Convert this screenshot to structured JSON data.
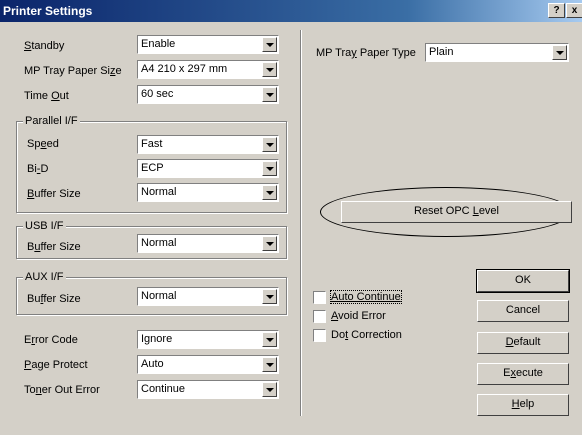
{
  "window": {
    "title": "Printer Settings",
    "help_btn": "?",
    "close_btn": "x"
  },
  "fields": {
    "standby": {
      "label_pre": "",
      "label_ul": "S",
      "label_post": "tandby",
      "value": "Enable"
    },
    "mp_tray_paper_size": {
      "label_pre": "MP Tray Paper Si",
      "label_ul": "z",
      "label_post": "e",
      "value": "A4 210 x 297 mm"
    },
    "time_out": {
      "label_pre": "Time ",
      "label_ul": "O",
      "label_post": "ut",
      "value": "60 sec"
    },
    "error_code": {
      "label_pre": "E",
      "label_ul": "r",
      "label_post": "ror Code",
      "value": "Ignore"
    },
    "page_protect": {
      "label_pre": "",
      "label_ul": "P",
      "label_post": "age Protect",
      "value": "Auto"
    },
    "toner_out_error": {
      "label_pre": "To",
      "label_ul": "n",
      "label_post": "er Out Error",
      "value": "Continue"
    },
    "mp_tray_paper_type": {
      "label_pre": "MP Tra",
      "label_ul": "y",
      "label_post": " Paper Type",
      "value": "Plain"
    }
  },
  "parallel": {
    "legend": "Parallel I/F",
    "speed": {
      "label_pre": "Sp",
      "label_ul": "e",
      "label_post": "ed",
      "value": "Fast"
    },
    "bid": {
      "label_pre": "Bi",
      "label_ul": "-",
      "label_post": "D",
      "value": "ECP"
    },
    "buffer": {
      "label_pre": "",
      "label_ul": "B",
      "label_post": "uffer Size",
      "value": "Normal"
    }
  },
  "usb": {
    "legend": "USB I/F",
    "buffer": {
      "label_pre": "B",
      "label_ul": "u",
      "label_post": "ffer Size",
      "value": "Normal"
    }
  },
  "aux": {
    "legend": "AUX I/F",
    "buffer": {
      "label_pre": "Bu",
      "label_ul": "f",
      "label_post": "fer Size",
      "value": "Normal"
    }
  },
  "checks": {
    "auto_continue": {
      "label_pre": "",
      "label_ul": "Auto Continue",
      "label_post": "",
      "checked": false
    },
    "avoid_error": {
      "label_pre": "",
      "label_ul": "A",
      "label_post": "void Error",
      "checked": false
    },
    "dot_correction": {
      "label_pre": "Do",
      "label_ul": "t",
      "label_post": " Correction",
      "checked": false
    }
  },
  "buttons": {
    "reset_opc": {
      "pre": "Reset OPC ",
      "ul": "L",
      "post": "evel"
    },
    "ok": {
      "pre": "",
      "ul": "",
      "post": "OK"
    },
    "cancel": {
      "pre": "",
      "ul": "",
      "post": "Cancel"
    },
    "default": {
      "pre": "",
      "ul": "D",
      "post": "efault"
    },
    "execute": {
      "pre": "E",
      "ul": "x",
      "post": "ecute"
    },
    "help": {
      "pre": "",
      "ul": "H",
      "post": "elp"
    }
  }
}
